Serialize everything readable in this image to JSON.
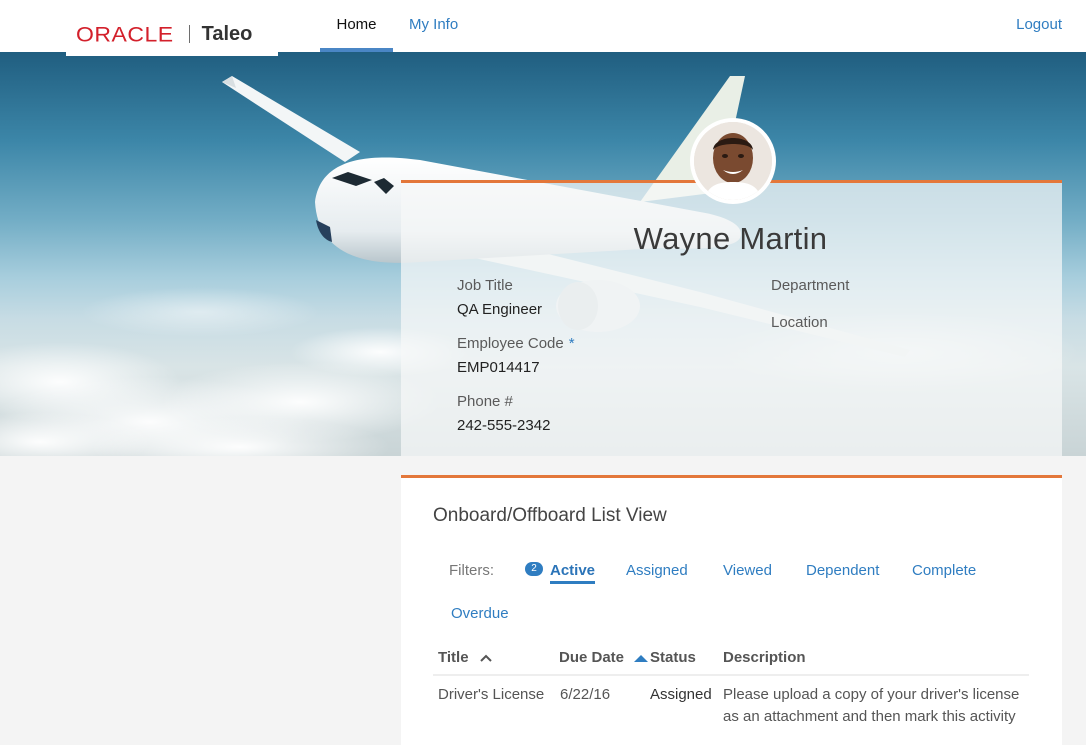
{
  "brand": {
    "oracle": "ORACLE",
    "product": "Taleo"
  },
  "nav": {
    "items": [
      {
        "label": "Home",
        "active": true
      },
      {
        "label": "My Info",
        "active": false
      }
    ],
    "logout": "Logout"
  },
  "profile": {
    "name": "Wayne Martin",
    "fields": {
      "job_title_label": "Job Title",
      "job_title_value": "QA Engineer",
      "employee_code_label": "Employee Code",
      "employee_code_required": "*",
      "employee_code_value": "EMP014417",
      "phone_label": "Phone #",
      "phone_value": "242-555-2342",
      "department_label": "Department",
      "location_label": "Location"
    }
  },
  "list": {
    "title": "Onboard/Offboard List View",
    "filters_label": "Filters:",
    "filters": [
      {
        "label": "Active",
        "badge": "2",
        "active": true
      },
      {
        "label": "Assigned",
        "active": false
      },
      {
        "label": "Viewed",
        "active": false
      },
      {
        "label": "Dependent",
        "active": false
      },
      {
        "label": "Complete",
        "active": false
      },
      {
        "label": "Overdue",
        "active": false
      }
    ],
    "columns": [
      "Title",
      "Due Date",
      "Status",
      "Description"
    ],
    "rows": [
      {
        "title": "Driver's License",
        "due_date": "6/22/16",
        "status": "Assigned",
        "description_line1": "Please upload a copy of your driver's license",
        "description_line2": "as an attachment and then mark this activity"
      }
    ]
  },
  "colors": {
    "accent_orange": "#e3773a",
    "link_blue": "#2f7dc1",
    "oracle_red": "#d3202b"
  },
  "icons": {
    "title_sort": "chevron-up-icon",
    "due_date_sort": "triangle-up-icon"
  }
}
